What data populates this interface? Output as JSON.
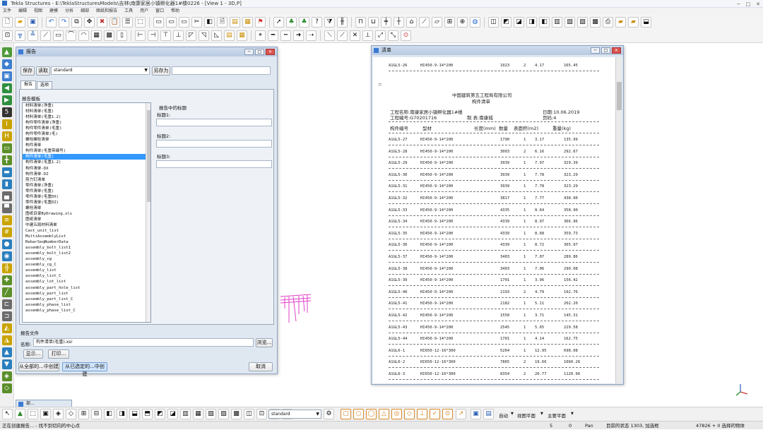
{
  "app": {
    "title": "Tekla Structures - E:\\TeklaStructuresModels\\吉林\\南康家居小镇孵化器1#楼0226 - [View 1 - 3D,P]",
    "window_controls": [
      "─",
      "□",
      "✕"
    ]
  },
  "menu": [
    "文件",
    "编辑",
    "视图",
    "建模",
    "分析",
    "细部",
    "图纸和报告",
    "工具",
    "用户",
    "窗口",
    "帮助"
  ],
  "colors": {
    "accent": "#3399ff",
    "dialog_bg": "#dfe7f1",
    "title_bar": "#c3d3ea"
  },
  "dialog": {
    "title": "报告",
    "save_label": "保存",
    "load_label": "读取",
    "preset": "standard",
    "save_as_label": "另存为",
    "save_as_value": "",
    "tabs": [
      "报告",
      "选项"
    ],
    "templates_label": "报告模板",
    "templates": [
      "材料清单(净重)",
      "材料清单(毛重)",
      "材料清单(毛重1.2)",
      "构件零件清单(净重)",
      "构件零件清单(毛重)",
      "构件零件清单(毛)",
      "螺栓螺栓清单",
      "构件清单",
      "构件清单(毛重带编号)",
      "构件清单(毛重)",
      "构件清单(毛重1.2)",
      "构件清单-DX",
      "构件清单-DZ",
      "剪力钉清单",
      "零件清单(净重)",
      "零件清单(毛重)",
      "零件清单(毛重DX)",
      "零件清单(毛重DZ)",
      "螺栓清单",
      "图纸目录ByDrawing.xls",
      "图纸清单",
      "中建五局材料清单",
      "Cast_unit_list",
      "MultiAssemblyList",
      "RebarSeqNumberData",
      "assembly_bolt_list1",
      "assembly_bolt_list2",
      "assembly_cg",
      "assembly_cg_C",
      "assembly_list",
      "assembly_list_C",
      "assembly_lot_list",
      "assembly_part_hole_list",
      "assembly_part_list",
      "assembly_part_list_C",
      "assembly_phase_list",
      "assembly_phase_list_C"
    ],
    "selected_index": 9,
    "titles_group": "报告中的标题",
    "title1_label": "标题1:",
    "title2_label": "标题2:",
    "title3_label": "标题3:",
    "title1": "",
    "title2": "",
    "title3": "",
    "file_group": "报告文件",
    "name_label": "名称:",
    "file_name": "构件清单(毛重).xsr",
    "browse_label": "浏览...",
    "display_label": "显示...",
    "print_label": "打印...",
    "create_all_label": "从全部的...中创建",
    "create_selected_label": "从已选定的...中创建",
    "cancel_label": "取消"
  },
  "viewer": {
    "title": "清单",
    "first_row": [
      "A1GL5-26",
      "HI450-9-14*200",
      "1023",
      "2",
      "4.17",
      "165.45"
    ],
    "company": "中国建筑第五工程局有限公司",
    "doc_title": "构件清单",
    "project_label": "工程名称:南康家居小镇孵化器1#楼",
    "project_no": "工程编号:G70201716",
    "maker": "制 表:南康城",
    "date": "日期:10.06.2019",
    "page": "页码:4",
    "columns": [
      "构件编号",
      "型材",
      "长度(mm)",
      "数量",
      "表面积(m2)",
      "重量(kg)"
    ],
    "rows": [
      [
        "A1GL5-27",
        "HI450-9-14*200",
        "1790",
        "1",
        "3.17",
        "135.99"
      ],
      [
        "A1GL5-28",
        "HI450-9-14*200",
        "3003",
        "2",
        "6.16",
        "292.67"
      ],
      [
        "A1GL5-29",
        "HI450-9-14*200",
        "3939",
        "1",
        "7.97",
        "329.39"
      ],
      [
        "A1GL5-30",
        "HI450-9-14*200",
        "3939",
        "1",
        "7.78",
        "323.29"
      ],
      [
        "A1GL5-31",
        "HI450-9-14*200",
        "3939",
        "1",
        "7.78",
        "323.29"
      ],
      [
        "A1GL5-32",
        "HI450-9-14*200",
        "3817",
        "1",
        "7.77",
        "438.90"
      ],
      [
        "A1GL5-33",
        "HI450-9-14*200",
        "4335",
        "1",
        "8.64",
        "358.90"
      ],
      [
        "A1GL5-34",
        "HI450-9-14*200",
        "4339",
        "1",
        "8.97",
        "366.96"
      ],
      [
        "A1GL5-35",
        "HI450-9-14*200",
        "4339",
        "1",
        "8.68",
        "359.73"
      ],
      [
        "A1GL5-36",
        "HI450-9-14*200",
        "4339",
        "1",
        "8.72",
        "365.97"
      ],
      [
        "A1GL5-37",
        "HI450-9-14*200",
        "3403",
        "1",
        "7.07",
        "289.86"
      ],
      [
        "A1GL5-38",
        "HI450-9-14*200",
        "3403",
        "1",
        "7.06",
        "290.08"
      ],
      [
        "A1GL5-39",
        "HI450-9-14*200",
        "1701",
        "1",
        "3.96",
        "156.42"
      ],
      [
        "A1GL5-40",
        "HI450-9-14*200",
        "2193",
        "2",
        "4.79",
        "192.76"
      ],
      [
        "A1GL5-41",
        "HI450-9-14*200",
        "2182",
        "1",
        "5.11",
        "202.20"
      ],
      [
        "A1GL5-42",
        "HI450-9-14*200",
        "1550",
        "1",
        "3.71",
        "145.31"
      ],
      [
        "A1GL5-43",
        "HI450-9-14*200",
        "2545",
        "1",
        "5.65",
        "229.58"
      ],
      [
        "A1GL5-44",
        "HI450-9-14*200",
        "1701",
        "1",
        "4.14",
        "162.75"
      ],
      [
        "A1GL6-1",
        "HI650-12-16*300",
        "5264",
        "1",
        "12.95",
        "698.08"
      ],
      [
        "A1GL6-2",
        "HI650-12-16*300",
        "7865",
        "2",
        "19.66",
        "1060.26"
      ],
      [
        "A1GL6-3",
        "HI650-12-16*300",
        "8354",
        "2",
        "20.77",
        "1120.96"
      ]
    ]
  },
  "minimized_window": "部...",
  "bottom": {
    "combo_value": "standard",
    "snap_mode": "自动",
    "plane1": "视图平面",
    "plane2": "主要平面"
  },
  "status": {
    "message": "正在创建报告... - 找不到切向的中心点",
    "num1": "5",
    "num2": "0",
    "pan": "Pan",
    "selected_objects": "目前的状态 1303, 加选框",
    "selection_count": "47826 + 0 选择的物体"
  }
}
